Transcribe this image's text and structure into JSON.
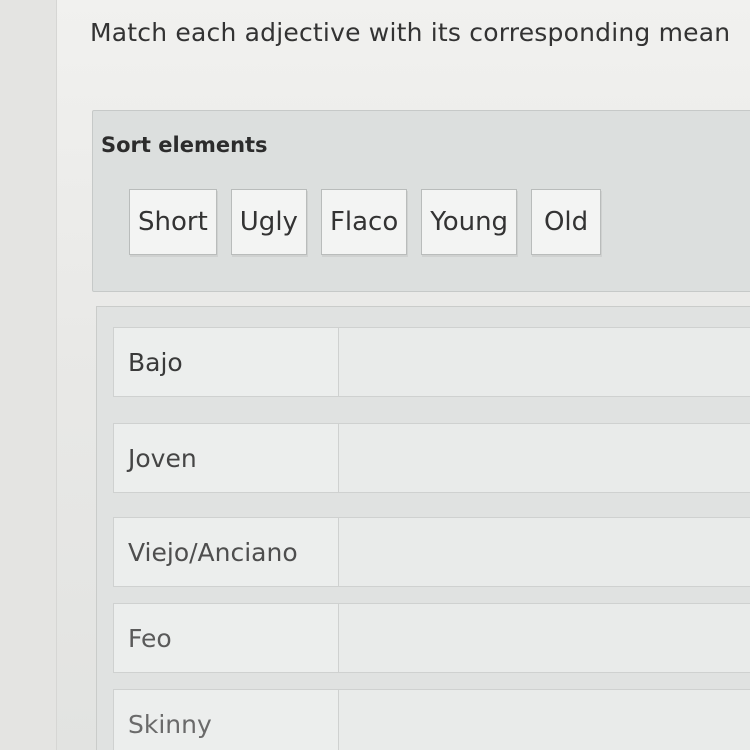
{
  "instruction": "Match each adjective with its corresponding mean",
  "sort_panel": {
    "title": "Sort elements",
    "chips": [
      "Short",
      "Ugly",
      "Flaco",
      "Young",
      "Old"
    ]
  },
  "match_rows": [
    "Bajo",
    "Joven",
    "Viejo/Anciano",
    "Feo",
    "Skinny"
  ]
}
